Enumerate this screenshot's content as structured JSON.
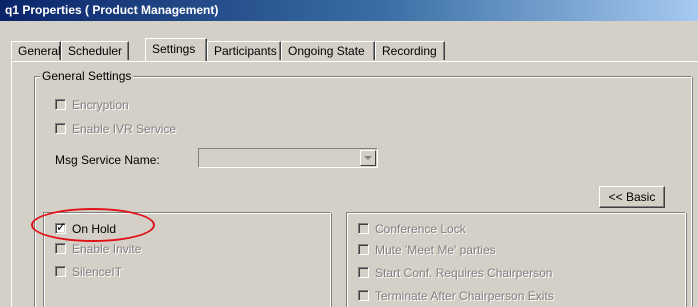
{
  "window": {
    "title": "q1 Properties  ( Product Management)"
  },
  "tabs": [
    {
      "label": "General",
      "active": false
    },
    {
      "label": "Scheduler",
      "active": false
    },
    {
      "label": "Settings",
      "active": true
    },
    {
      "label": "Participants",
      "active": false
    },
    {
      "label": "Ongoing State",
      "active": false
    },
    {
      "label": "Recording",
      "active": false
    }
  ],
  "general_settings": {
    "legend": "General Settings",
    "encryption": {
      "label": "Encryption",
      "checked": false,
      "enabled": false
    },
    "enable_ivr": {
      "label": "Enable IVR Service",
      "checked": false,
      "enabled": false
    },
    "msg_service": {
      "label": "Msg Service Name:",
      "value": "",
      "enabled": false
    },
    "basic_button": {
      "label": "<< Basic"
    }
  },
  "left_options": {
    "on_hold": {
      "label": "On Hold",
      "checked": true,
      "enabled": true
    },
    "enable_invite": {
      "label": "Enable Invite",
      "checked": false,
      "enabled": false
    },
    "silence_it": {
      "label": "SilenceIT",
      "checked": false,
      "enabled": false
    }
  },
  "right_options": {
    "conference_lock": {
      "label": "Conference Lock",
      "checked": false,
      "enabled": false
    },
    "mute_meet_me": {
      "label": "Mute 'Meet Me' parties",
      "checked": false,
      "enabled": false
    },
    "start_conf_requires_chair": {
      "label": "Start Conf. Requires Chairperson",
      "checked": false,
      "enabled": false
    },
    "terminate_after_chair": {
      "label": "Terminate After Chairperson Exits",
      "checked": false,
      "enabled": false
    }
  },
  "annotation": {
    "highlight_color": "#e0121a",
    "target": "on_hold"
  },
  "check_glyph": "✓"
}
